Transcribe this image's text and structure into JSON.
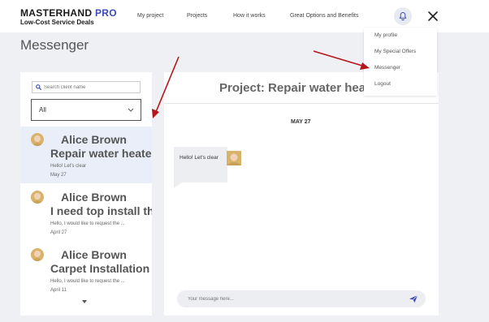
{
  "header": {
    "brand_main": "MASTERHAND",
    "brand_accent": "PRO",
    "tagline": "Low-Cost Service Deals",
    "nav": [
      "My project",
      "Projects",
      "How it works",
      "Great Options and Benefits"
    ],
    "bell_icon": "bell-icon",
    "close_icon": "close-icon"
  },
  "page": {
    "title": "Messenger"
  },
  "sidebar": {
    "search_placeholder": "Search client name",
    "filter_value": "All",
    "conversations": [
      {
        "name": "Alice Brown",
        "project": "Repair water heater",
        "preview": "Hello! Let's clear",
        "date": "May 27"
      },
      {
        "name": "Alice Brown",
        "project": "I need top install the",
        "preview": "Hello, I would like to request the ...",
        "date": "April 27"
      },
      {
        "name": "Alice Brown",
        "project": "Carpet Installation",
        "preview": "Hello, I would like to request the ...",
        "date": "April 11"
      }
    ]
  },
  "chat": {
    "project_title": "Project: Repair water heater",
    "date_separator": "MAY 27",
    "messages": [
      {
        "text": "Hello! Let's clear"
      }
    ],
    "input_placeholder": "Your message here...",
    "send_icon": "send-icon"
  },
  "user_menu": {
    "items": [
      "My profile",
      "My Special Offers",
      "Messenger",
      "Logout"
    ]
  },
  "colors": {
    "accent": "#3b4bb5",
    "annotation_arrow": "#b5161b",
    "active_row": "#e9eef8"
  }
}
